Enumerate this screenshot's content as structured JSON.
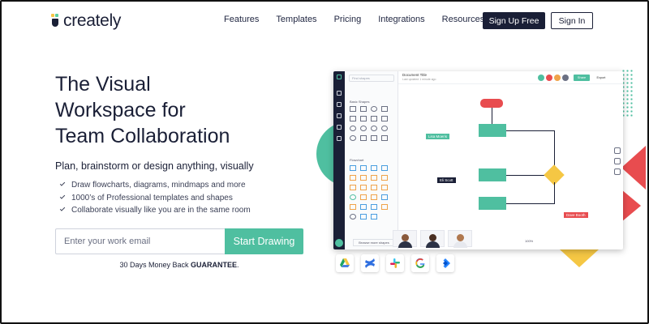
{
  "brand": {
    "name": "creately"
  },
  "nav": {
    "items": [
      "Features",
      "Templates",
      "Pricing",
      "Integrations",
      "Resources"
    ],
    "signup_label": "Sign Up Free",
    "signin_label": "Sign In"
  },
  "hero": {
    "title_lines": [
      "The Visual",
      "Workspace for",
      "Team Collaboration"
    ],
    "subtitle": "Plan, brainstorm or design anything, visually",
    "features": [
      "Draw flowcharts, diagrams, mindmaps and more",
      "1000’s of Professional templates and shapes",
      "Collaborate visually like you are in the same room"
    ],
    "email_placeholder": "Enter your work email",
    "cta_label": "Start Drawing",
    "guarantee_prefix": "30 Days Money Back ",
    "guarantee_strong": "GUARANTEE",
    "guarantee_suffix": "."
  },
  "app_preview": {
    "search_placeholder": "Find shapes",
    "basic_shapes_label": "Basic Shapes",
    "flowchart_label": "Flowchart",
    "browse_label": "Browse more shapes",
    "doc_title": "Document Title",
    "doc_subtitle": "Last updated 1 minute ago",
    "share_label": "Share",
    "export_label": "Export",
    "cursor_labels": [
      "Lisa Moeris",
      "Eli Scott",
      "Dave Booth"
    ],
    "zoom": "100%",
    "avatar_letters": [
      "S",
      "A",
      "M",
      "D"
    ]
  },
  "integrations": [
    "google-drive-icon",
    "confluence-icon",
    "slack-icon",
    "google-icon",
    "jira-icon"
  ],
  "colors": {
    "navy": "#1a1f36",
    "teal": "#4fbfa0",
    "red": "#e84c4f",
    "yellow": "#f5c744"
  }
}
